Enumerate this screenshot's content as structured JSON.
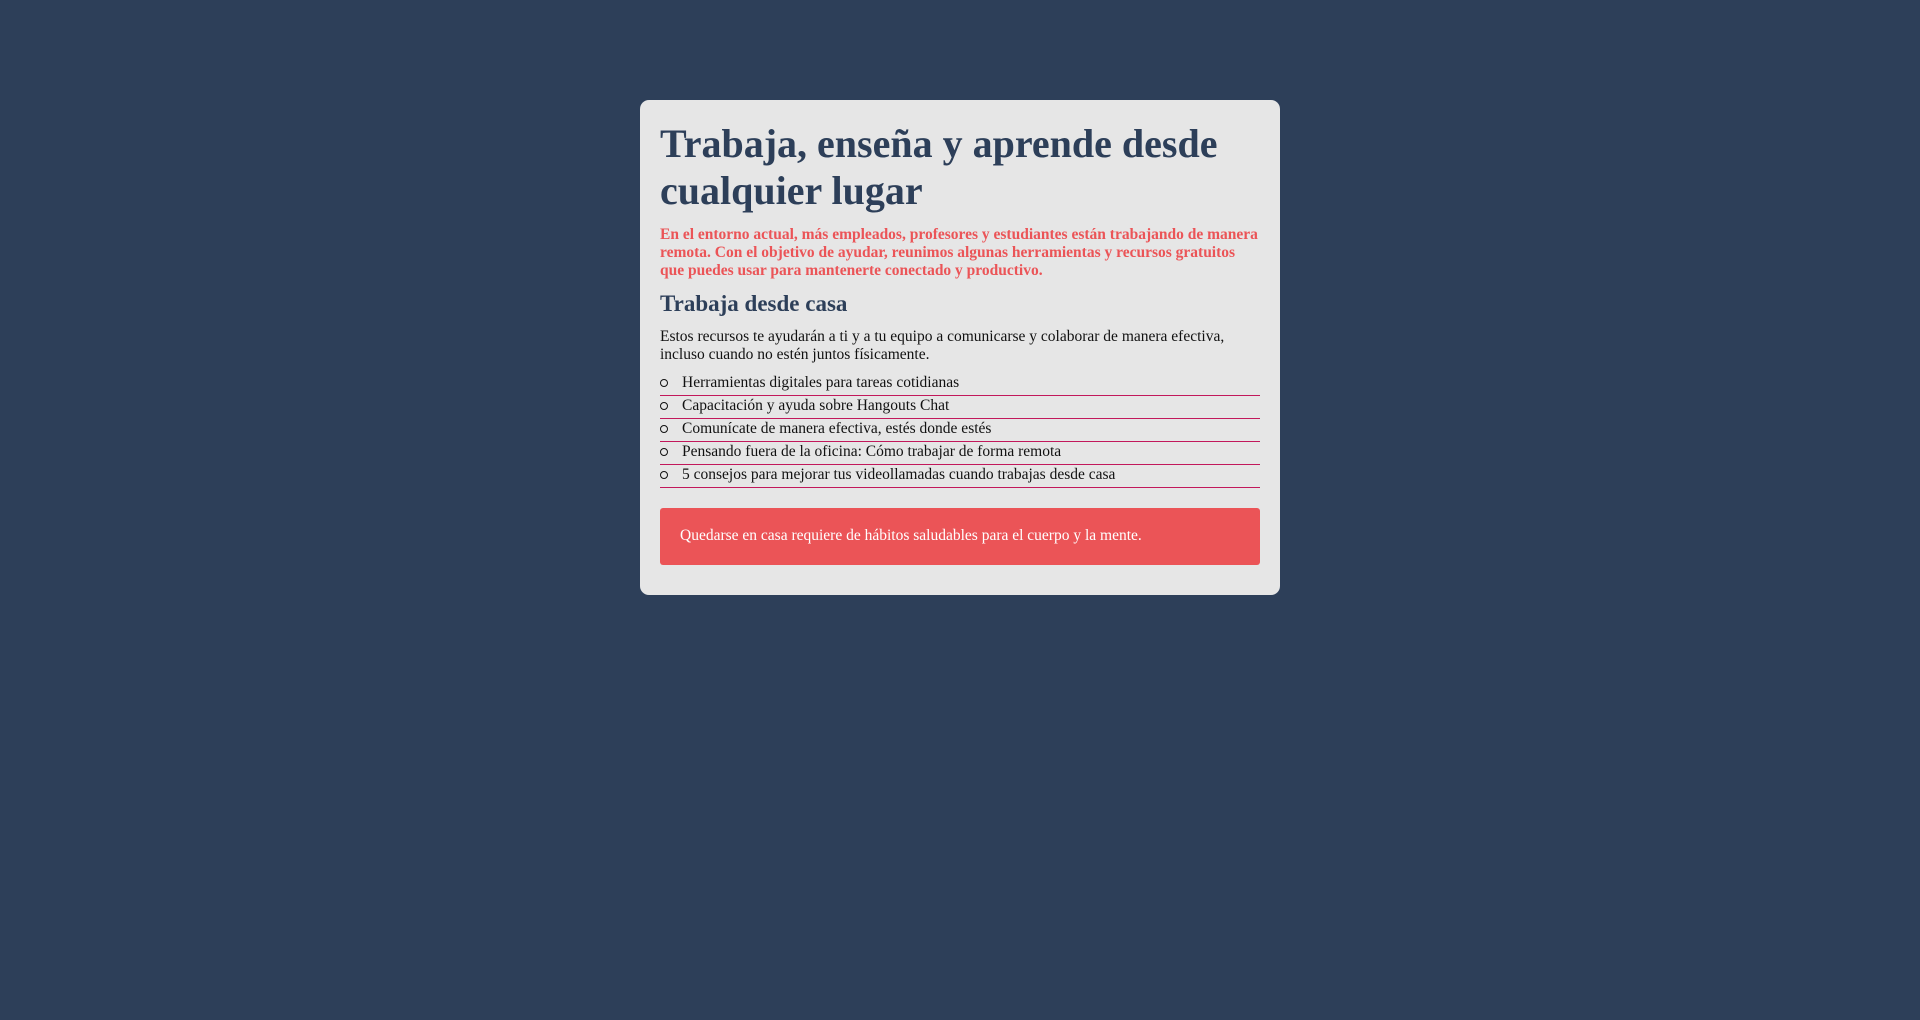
{
  "article": {
    "title": "Trabaja, enseña y aprende desde cualquier lugar",
    "lead": "En el entorno actual, más empleados, profesores y estudiantes están trabajando de manera remota. Con el objetivo de ayudar, reunimos algunas herramientas y recursos gratuitos que puedes usar para mantenerte conectado y productivo.",
    "section_title": "Trabaja desde casa",
    "section_text": "Estos recursos te ayudarán a ti y a tu equipo a comunicarse y colaborar de manera efectiva, incluso cuando no estén juntos físicamente.",
    "resources": [
      "Herramientas digitales para tareas cotidianas",
      "Capacitación y ayuda sobre Hangouts Chat",
      "Comunícate de manera efectiva, estés donde estés",
      "Pensando fuera de la oficina: Cómo trabajar de forma remota",
      "5 consejos para mejorar tus videollamadas cuando trabajas desde casa"
    ],
    "notice": "Quedarse en casa requiere de hábitos saludables para el cuerpo y la mente."
  },
  "colors": {
    "background": "#2d3f59",
    "card": "#e6e6e6",
    "accent": "#eb5457",
    "link_underline": "#c2185b"
  }
}
